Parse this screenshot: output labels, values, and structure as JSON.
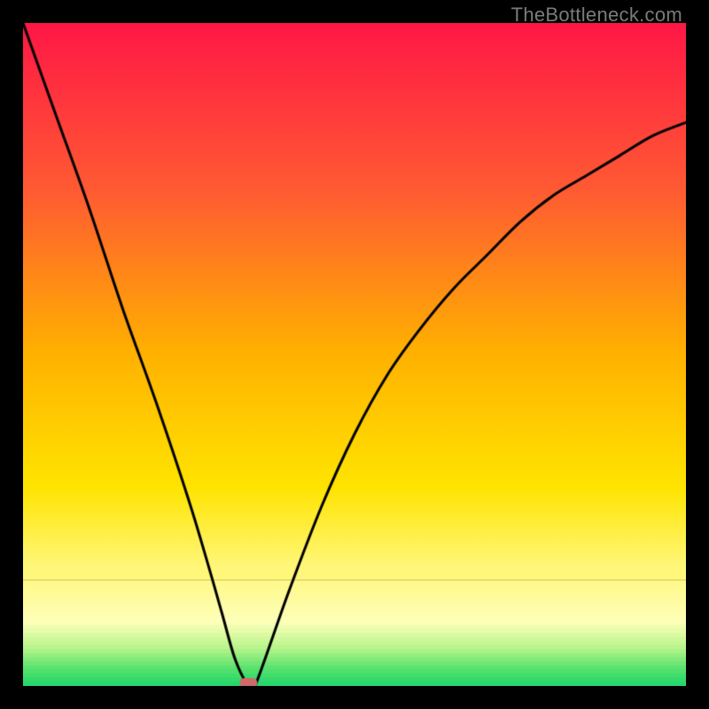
{
  "watermark": "TheBottleneck.com",
  "chart_data": {
    "type": "line",
    "title": "",
    "xlabel": "",
    "ylabel": "",
    "xlim": [
      0,
      100
    ],
    "ylim": [
      0,
      100
    ],
    "grid": false,
    "legend": false,
    "background": {
      "kind": "vertical-gradient",
      "stops": [
        {
          "pos": 0.0,
          "color": "#ff1746"
        },
        {
          "pos": 0.25,
          "color": "#ff5a33"
        },
        {
          "pos": 0.5,
          "color": "#ffb200"
        },
        {
          "pos": 0.7,
          "color": "#ffe400"
        },
        {
          "pos": 0.82,
          "color": "#fff77a"
        },
        {
          "pos": 0.9,
          "color": "#feffba"
        },
        {
          "pos": 0.94,
          "color": "#b6f58a"
        },
        {
          "pos": 0.97,
          "color": "#5ae26d"
        },
        {
          "pos": 1.0,
          "color": "#17d56a"
        }
      ]
    },
    "series": [
      {
        "name": "bottleneck-curve",
        "color": "#000000",
        "x": [
          0,
          5,
          10,
          15,
          20,
          25,
          28,
          30,
          32,
          34,
          35,
          40,
          45,
          50,
          55,
          60,
          65,
          70,
          75,
          80,
          85,
          90,
          95,
          100
        ],
        "values": [
          100,
          86,
          72,
          57,
          43,
          28,
          18,
          11,
          4,
          0,
          0,
          14,
          27,
          38,
          47,
          54,
          60,
          65,
          70,
          74,
          77,
          80,
          83,
          85
        ]
      }
    ],
    "marker": {
      "name": "optimal-point",
      "x": 34,
      "y": 0,
      "color": "#cf6a6a",
      "shape": "capsule"
    }
  }
}
